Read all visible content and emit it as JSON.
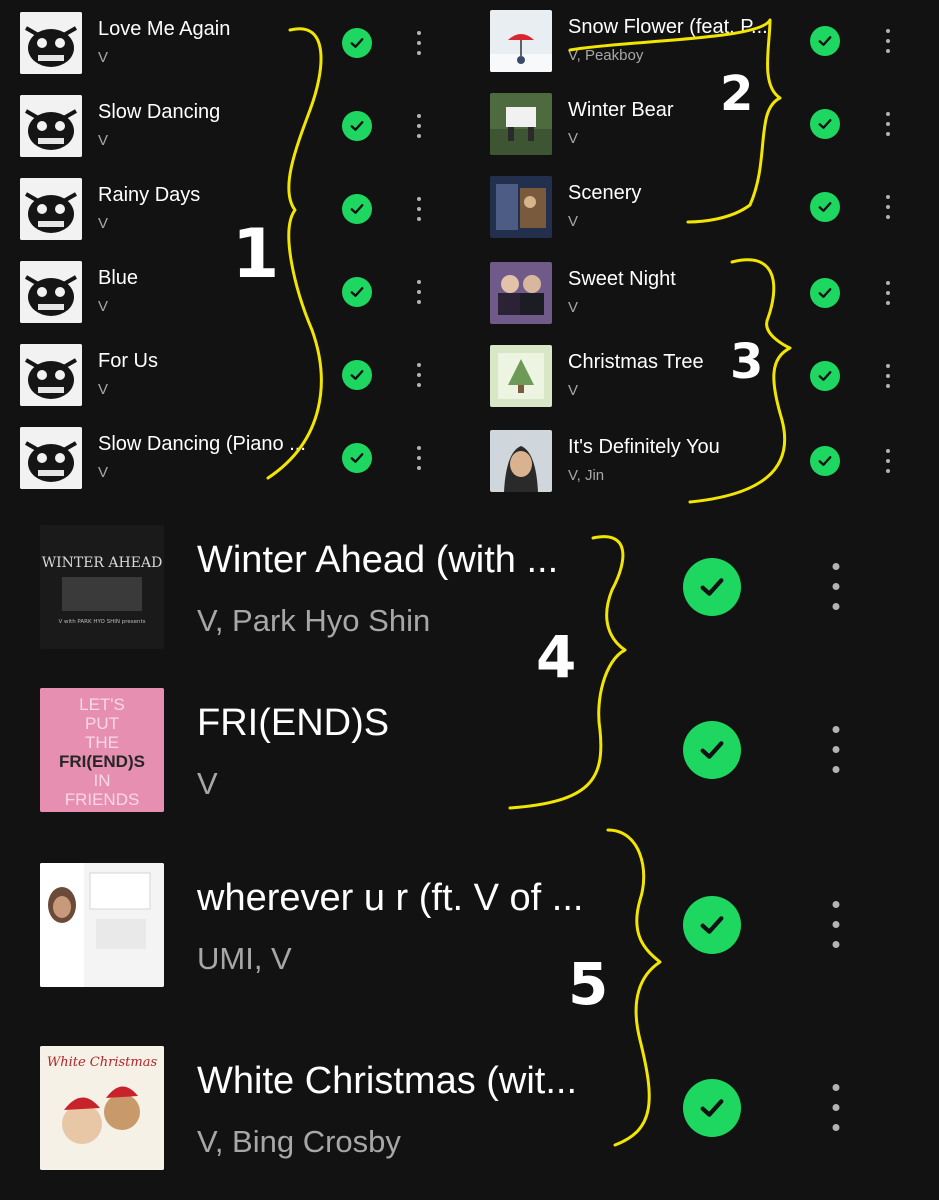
{
  "left_column": [
    {
      "title": "Love Me Again",
      "artist": "V",
      "saved": true
    },
    {
      "title": "Slow Dancing",
      "artist": "V",
      "saved": true
    },
    {
      "title": "Rainy Days",
      "artist": "V",
      "saved": true
    },
    {
      "title": "Blue",
      "artist": "V",
      "saved": true
    },
    {
      "title": "For Us",
      "artist": "V",
      "saved": true
    },
    {
      "title": "Slow Dancing (Piano ...",
      "artist": "V",
      "saved": true
    }
  ],
  "right_column": [
    {
      "title": "Snow Flower (feat. P...",
      "artist": "V, Peakboy",
      "saved": true
    },
    {
      "title": "Winter Bear",
      "artist": "V",
      "saved": true
    },
    {
      "title": "Scenery",
      "artist": "V",
      "saved": true
    },
    {
      "title": "Sweet Night",
      "artist": "V",
      "saved": true
    },
    {
      "title": "Christmas Tree",
      "artist": "V",
      "saved": true
    },
    {
      "title": "It's Definitely You",
      "artist": "V, Jin",
      "saved": true
    }
  ],
  "large_list": [
    {
      "title": "Winter Ahead (with ...",
      "artist": "V, Park Hyo Shin",
      "saved": true,
      "cover_text": {
        "line1": "WINTER AHEAD",
        "line2": "V with PARK HYO SHIN presents"
      }
    },
    {
      "title": "FRI(END)S",
      "artist": "V",
      "saved": true,
      "cover_text": {
        "lines": [
          "LET'S",
          "PUT",
          "THE",
          "FRI(END)S",
          "IN",
          "FRIENDS"
        ]
      }
    },
    {
      "title": "wherever u r (ft. V of ...",
      "artist": "UMI, V",
      "saved": true
    },
    {
      "title": "White Christmas (wit...",
      "artist": "V, Bing Crosby",
      "saved": true,
      "cover_text": {
        "line1": "White Christmas"
      }
    }
  ],
  "annotations": {
    "labels": [
      "1",
      "2",
      "3",
      "4",
      "5"
    ],
    "color": "#f2e600"
  },
  "colors": {
    "background": "#121212",
    "saved_check": "#1ed760",
    "title": "#ffffff",
    "subtitle": "#a7a7a7",
    "more_dots": "#b3b3b3"
  },
  "icons": {
    "saved": "check-circle-icon",
    "more": "more-vertical-icon"
  }
}
